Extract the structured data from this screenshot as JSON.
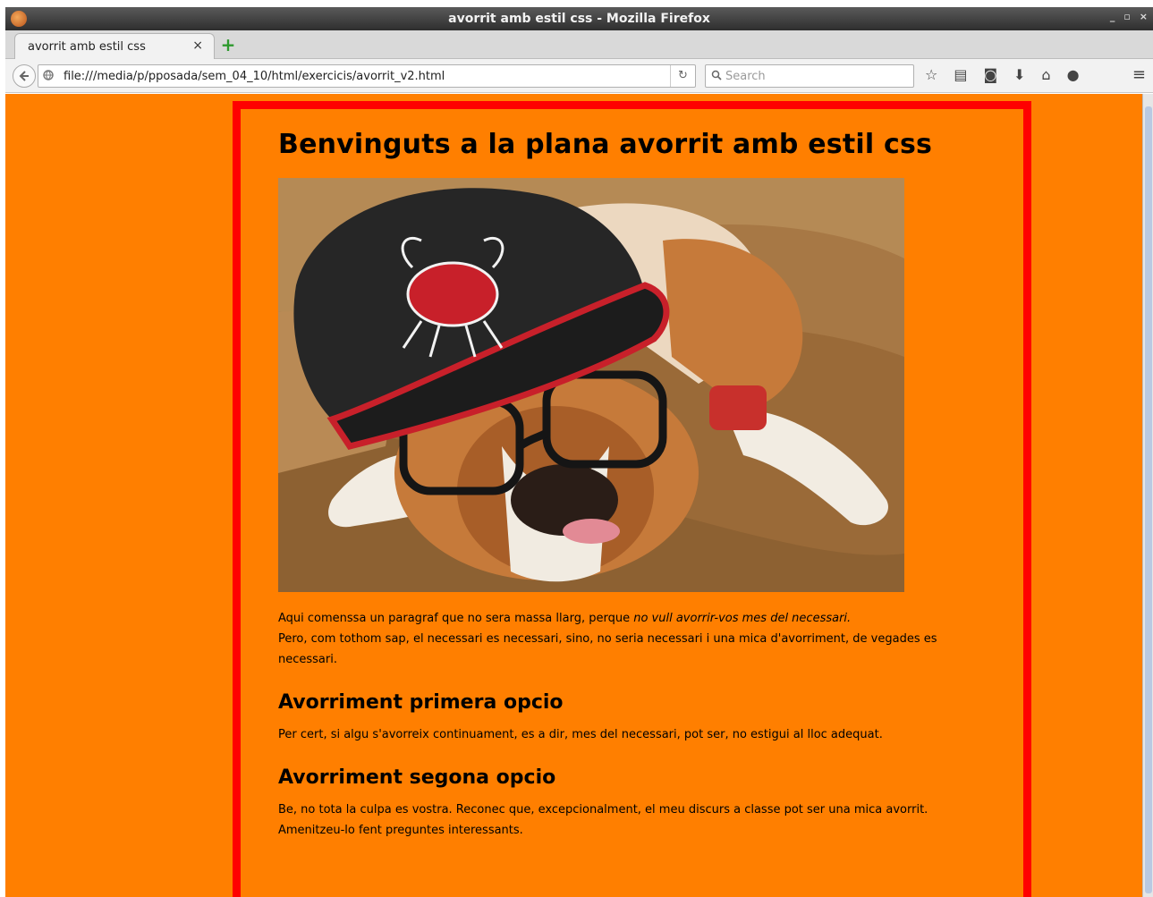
{
  "window": {
    "title": "avorrit amb estil css - Mozilla Firefox",
    "controls": [
      "_",
      "▫",
      "×"
    ]
  },
  "tabs": [
    {
      "label": "avorrit amb estil css",
      "close": "×"
    }
  ],
  "new_tab_icon": "+",
  "navbar": {
    "url": "file:///media/p/pposada/sem_04_10/html/exercicis/avorrit_v2.html",
    "search_placeholder": "Search",
    "reload_icon": "↻"
  },
  "colors": {
    "page_background": "#ff7f00",
    "box_border": "#ff0000"
  },
  "page": {
    "heading": "Benvinguts a la plana avorrit amb estil css",
    "intro_part1": "Aqui comenssa un paragraf que no sera massa llarg, perque ",
    "intro_emphasis": "no vull avorrir-vos mes del necessari.",
    "intro_part2": "Pero, com tothom sap, el necessari es necessari, sino, no seria necessari i una mica d'avorriment, de vegades es necessari.",
    "section1_title": "Avorriment primera opcio",
    "section1_text": "Per cert, si algu s'avorreix continuament, es a dir, mes del necessari, pot ser, no estigui al lloc adequat.",
    "section2_title": "Avorriment segona opcio",
    "section2_text": "Be, no tota la culpa es vostra. Reconec que, excepcionalment, el meu discurs a classe pot ser una mica avorrit. Amenitzeu-lo fent preguntes interessants."
  }
}
